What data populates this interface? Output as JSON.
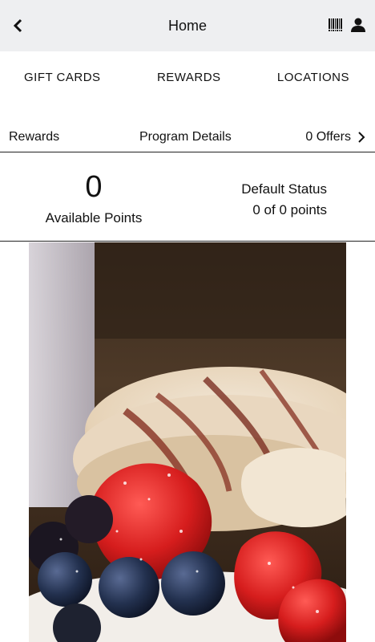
{
  "header": {
    "title": "Home",
    "back_icon": "chevron-left-icon",
    "barcode_icon": "barcode-icon",
    "account_icon": "user-icon"
  },
  "nav": {
    "tabs": [
      "GIFT CARDS",
      "REWARDS",
      "LOCATIONS"
    ]
  },
  "subnav": {
    "rewards": "Rewards",
    "program_details": "Program Details",
    "offers": "0 Offers"
  },
  "status": {
    "points": "0",
    "points_label": "Available Points",
    "status_title": "Default Status",
    "status_progress": "0 of 0 points"
  },
  "colors": {
    "header_bg": "#eeeff1",
    "divider": "#222222"
  }
}
